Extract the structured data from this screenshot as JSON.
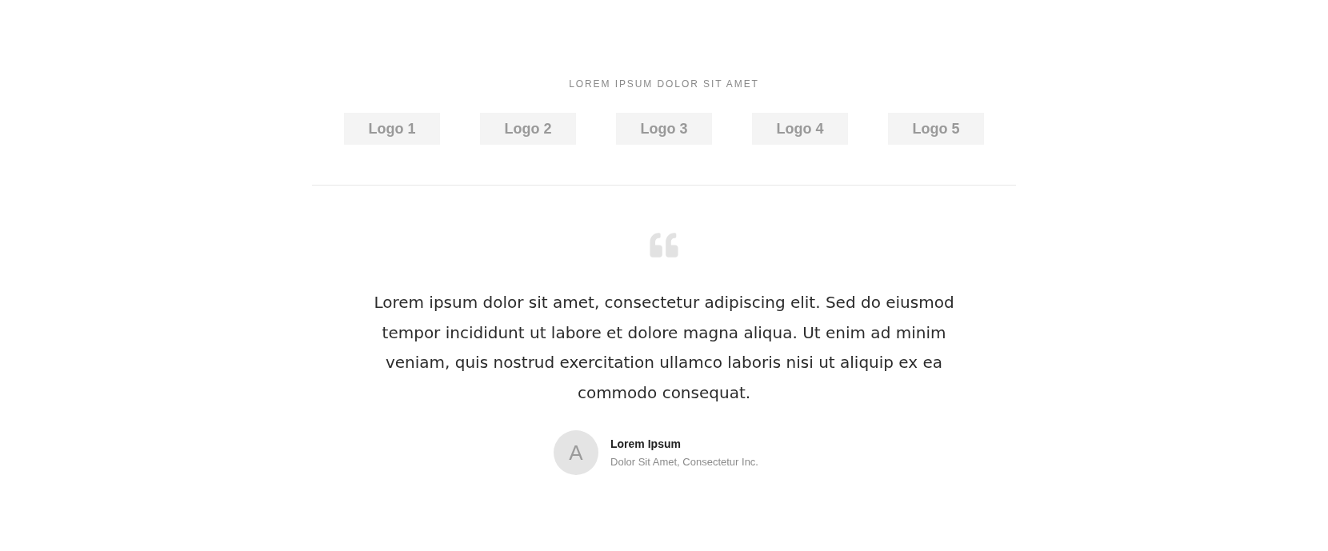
{
  "section_label": "LOREM IPSUM DOLOR SIT AMET",
  "logos": [
    "Logo 1",
    "Logo 2",
    "Logo 3",
    "Logo 4",
    "Logo 5"
  ],
  "testimonial": {
    "quote": "Lorem ipsum dolor sit amet, consectetur adipiscing elit. Sed do eiusmod tempor incididunt ut labore et dolore magna aliqua. Ut enim ad minim veniam, quis nostrud exercitation ullamco laboris nisi ut aliquip ex ea commodo consequat.",
    "author": {
      "initial": "A",
      "name": "Lorem Ipsum",
      "title": "Dolor Sit Amet, Consectetur Inc."
    }
  }
}
